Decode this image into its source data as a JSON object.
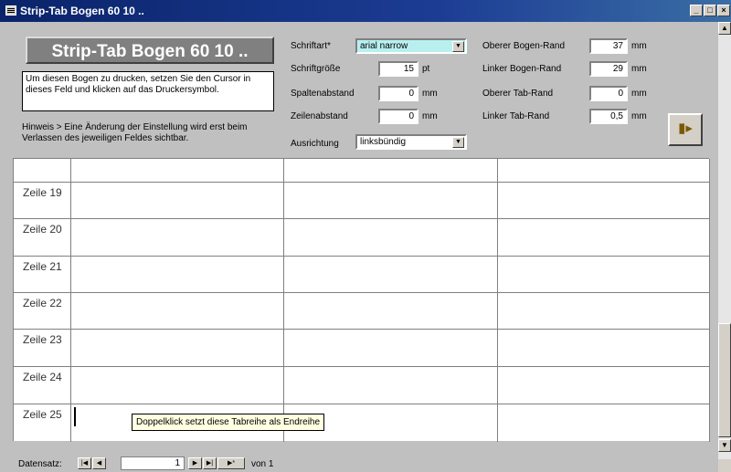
{
  "window": {
    "title": "Strip-Tab Bogen 60 10 .."
  },
  "header": {
    "title": "Strip-Tab Bogen 60 10 ..",
    "info_text": "Um diesen Bogen zu drucken, setzen Sie den Cursor in dieses Feld und klicken auf das Druckersymbol.",
    "hint_text": "Hinweis > Eine Änderung der Einstellung wird erst beim Verlassen des jeweiligen Feldes sichtbar."
  },
  "settings": {
    "schriftart_label": "Schriftart*",
    "schriftart_value": "arial narrow",
    "schriftgroesse_label": "Schriftgröße",
    "schriftgroesse_value": "15",
    "schriftgroesse_unit": "pt",
    "spaltenabstand_label": "Spaltenabstand",
    "spaltenabstand_value": "0",
    "spaltenabstand_unit": "mm",
    "zeilenabstand_label": "Zeilenabstand",
    "zeilenabstand_value": "0",
    "zeilenabstand_unit": "mm",
    "ausrichtung_label": "Ausrichtung",
    "ausrichtung_value": "linksbündig",
    "oberer_bogen_label": "Oberer Bogen-Rand",
    "oberer_bogen_value": "37",
    "oberer_bogen_unit": "mm",
    "linker_bogen_label": "Linker Bogen-Rand",
    "linker_bogen_value": "29",
    "linker_bogen_unit": "mm",
    "oberer_tab_label": "Oberer Tab-Rand",
    "oberer_tab_value": "0",
    "oberer_tab_unit": "mm",
    "linker_tab_label": "Linker Tab-Rand",
    "linker_tab_value": "0,5",
    "linker_tab_unit": "mm"
  },
  "grid": {
    "rows": [
      "",
      "Zeile 19",
      "Zeile 20",
      "Zeile 21",
      "Zeile 22",
      "Zeile 23",
      "Zeile 24",
      "Zeile 25"
    ]
  },
  "tooltip": "Doppelklick setzt diese Tabreihe als Endreihe",
  "navigator": {
    "label": "Datensatz:",
    "current": "1",
    "of_text": "von 1"
  },
  "icons": {
    "exit": "exit-door-icon",
    "window": "form-icon"
  }
}
